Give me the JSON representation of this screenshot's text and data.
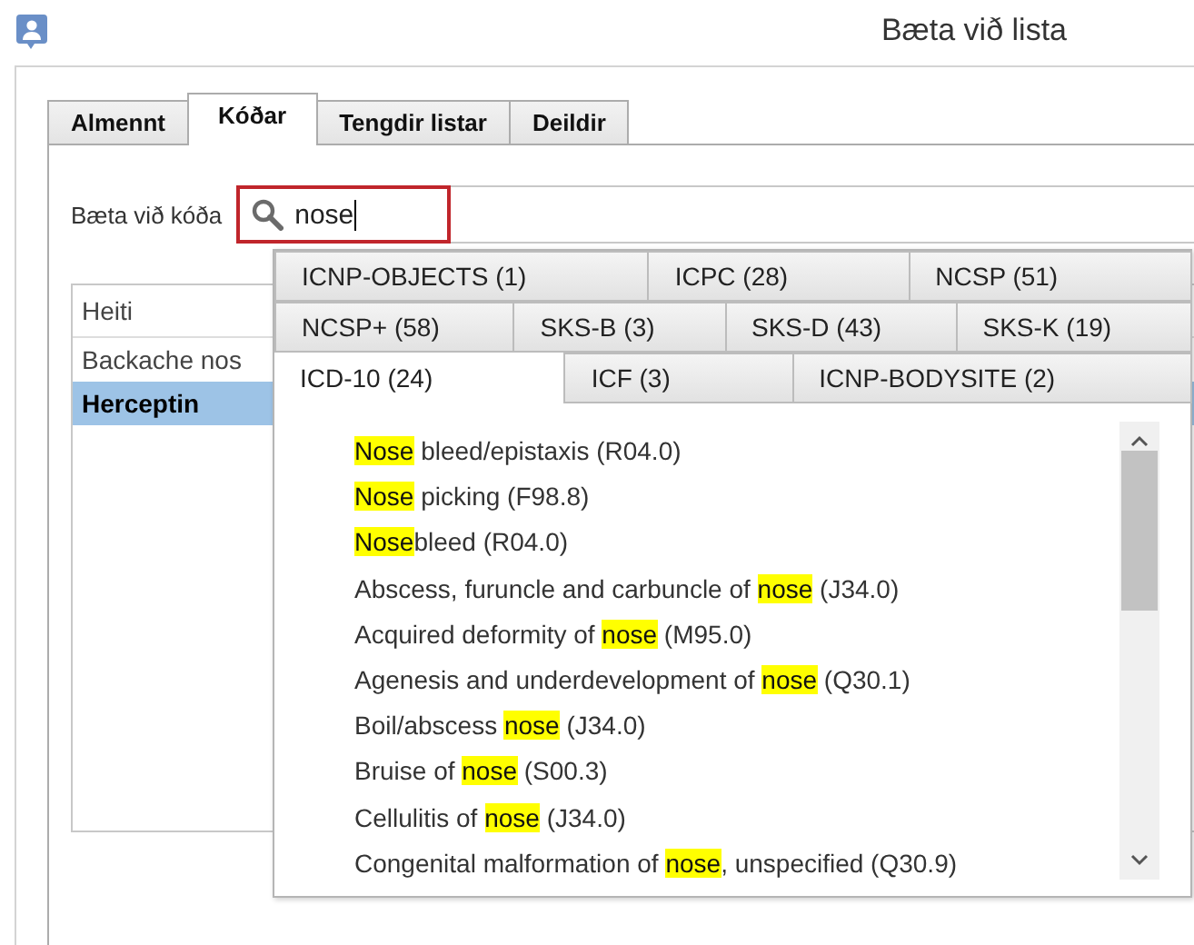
{
  "window": {
    "title": "Bæta við lista"
  },
  "tabs": [
    {
      "label": "Almennt",
      "selected": false
    },
    {
      "label": "Kóðar",
      "selected": true
    },
    {
      "label": "Tengdir listar",
      "selected": false
    },
    {
      "label": "Deildir",
      "selected": false
    }
  ],
  "search": {
    "label": "Bæta við kóða",
    "value": "nose"
  },
  "table": {
    "columns": [
      "Heiti"
    ],
    "rows": [
      {
        "name": "Backache nos",
        "selected": false
      },
      {
        "name": "Herceptin",
        "selected": true
      }
    ]
  },
  "popup": {
    "tab_rows": [
      [
        {
          "label": "ICNP-OBJECTS (1)",
          "selected": false
        },
        {
          "label": "ICPC (28)",
          "selected": false
        },
        {
          "label": "NCSP (51)",
          "selected": false
        }
      ],
      [
        {
          "label": "NCSP+ (58)",
          "selected": false
        },
        {
          "label": "SKS-B (3)",
          "selected": false
        },
        {
          "label": "SKS-D (43)",
          "selected": false
        },
        {
          "label": "SKS-K (19)",
          "selected": false
        }
      ],
      [
        {
          "label": "ICD-10 (24)",
          "selected": true
        },
        {
          "label": "ICF (3)",
          "selected": false
        },
        {
          "label": "ICNP-BODYSITE (2)",
          "selected": false
        }
      ]
    ],
    "results": [
      {
        "match": "Nose",
        "after": " bleed/epistaxis (R04.0)"
      },
      {
        "match": "Nose",
        "after": " picking (F98.8)"
      },
      {
        "match": "Nose",
        "after": "bleed (R04.0)"
      },
      {
        "before": "Abscess, furuncle and carbuncle of ",
        "match": "nose",
        "after": " (J34.0)"
      },
      {
        "before": "Acquired deformity of ",
        "match": "nose",
        "after": " (M95.0)"
      },
      {
        "before": "Agenesis and underdevelopment of ",
        "match": "nose",
        "after": " (Q30.1)"
      },
      {
        "before": "Boil/abscess ",
        "match": "nose",
        "after": " (J34.0)"
      },
      {
        "before": "Bruise of ",
        "match": "nose",
        "after": " (S00.3)"
      },
      {
        "before": "Cellulitis of ",
        "match": "nose",
        "after": " (J34.0)"
      },
      {
        "before": "Congenital malformation of ",
        "match": "nose",
        "after": ", unspecified (Q30.9)"
      }
    ]
  }
}
